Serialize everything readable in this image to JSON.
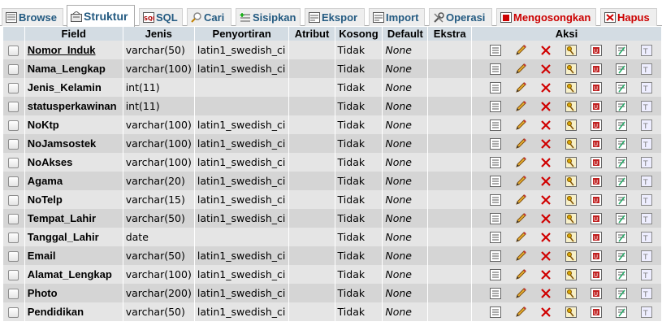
{
  "tabs": [
    {
      "label": "Browse",
      "icon": "browse-icon",
      "active": false
    },
    {
      "label": "Struktur",
      "icon": "structure-icon",
      "active": true
    },
    {
      "label": "SQL",
      "icon": "sql-icon",
      "active": false
    },
    {
      "label": "Cari",
      "icon": "search-icon",
      "active": false
    },
    {
      "label": "Sisipkan",
      "icon": "insert-icon",
      "active": false
    },
    {
      "label": "Ekspor",
      "icon": "export-icon",
      "active": false
    },
    {
      "label": "Import",
      "icon": "import-icon",
      "active": false
    },
    {
      "label": "Operasi",
      "icon": "operations-icon",
      "active": false
    },
    {
      "label": "Mengosongkan",
      "icon": "empty-icon",
      "active": false
    },
    {
      "label": "Hapus",
      "icon": "drop-icon",
      "active": false
    }
  ],
  "headers": {
    "field": "Field",
    "jenis": "Jenis",
    "penyortiran": "Penyortiran",
    "atribut": "Atribut",
    "kosong": "Kosong",
    "default": "Default",
    "ekstra": "Ekstra",
    "aksi": "Aksi"
  },
  "rows": [
    {
      "field": "Nomor_Induk",
      "jenis": "varchar(50)",
      "penyortiran": "latin1_swedish_ci",
      "atribut": "",
      "kosong": "Tidak",
      "default": "None",
      "ekstra": ""
    },
    {
      "field": "Nama_Lengkap",
      "jenis": "varchar(100)",
      "penyortiran": "latin1_swedish_ci",
      "atribut": "",
      "kosong": "Tidak",
      "default": "None",
      "ekstra": ""
    },
    {
      "field": "Jenis_Kelamin",
      "jenis": "int(11)",
      "penyortiran": "",
      "atribut": "",
      "kosong": "Tidak",
      "default": "None",
      "ekstra": ""
    },
    {
      "field": "statusperkawinan",
      "jenis": "int(11)",
      "penyortiran": "",
      "atribut": "",
      "kosong": "Tidak",
      "default": "None",
      "ekstra": ""
    },
    {
      "field": "NoKtp",
      "jenis": "varchar(100)",
      "penyortiran": "latin1_swedish_ci",
      "atribut": "",
      "kosong": "Tidak",
      "default": "None",
      "ekstra": ""
    },
    {
      "field": "NoJamsostek",
      "jenis": "varchar(100)",
      "penyortiran": "latin1_swedish_ci",
      "atribut": "",
      "kosong": "Tidak",
      "default": "None",
      "ekstra": ""
    },
    {
      "field": "NoAkses",
      "jenis": "varchar(100)",
      "penyortiran": "latin1_swedish_ci",
      "atribut": "",
      "kosong": "Tidak",
      "default": "None",
      "ekstra": ""
    },
    {
      "field": "Agama",
      "jenis": "varchar(20)",
      "penyortiran": "latin1_swedish_ci",
      "atribut": "",
      "kosong": "Tidak",
      "default": "None",
      "ekstra": ""
    },
    {
      "field": "NoTelp",
      "jenis": "varchar(15)",
      "penyortiran": "latin1_swedish_ci",
      "atribut": "",
      "kosong": "Tidak",
      "default": "None",
      "ekstra": ""
    },
    {
      "field": "Tempat_Lahir",
      "jenis": "varchar(50)",
      "penyortiran": "latin1_swedish_ci",
      "atribut": "",
      "kosong": "Tidak",
      "default": "None",
      "ekstra": ""
    },
    {
      "field": "Tanggal_Lahir",
      "jenis": "date",
      "penyortiran": "",
      "atribut": "",
      "kosong": "Tidak",
      "default": "None",
      "ekstra": ""
    },
    {
      "field": "Email",
      "jenis": "varchar(50)",
      "penyortiran": "latin1_swedish_ci",
      "atribut": "",
      "kosong": "Tidak",
      "default": "None",
      "ekstra": ""
    },
    {
      "field": "Alamat_Lengkap",
      "jenis": "varchar(100)",
      "penyortiran": "latin1_swedish_ci",
      "atribut": "",
      "kosong": "Tidak",
      "default": "None",
      "ekstra": ""
    },
    {
      "field": "Photo",
      "jenis": "varchar(200)",
      "penyortiran": "latin1_swedish_ci",
      "atribut": "",
      "kosong": "Tidak",
      "default": "None",
      "ekstra": ""
    },
    {
      "field": "Pendidikan",
      "jenis": "varchar(50)",
      "penyortiran": "latin1_swedish_ci",
      "atribut": "",
      "kosong": "Tidak",
      "default": "None",
      "ekstra": ""
    }
  ],
  "primary_key_field": "Nomor_Induk",
  "row_actions": [
    "browse-distinct-icon",
    "edit-pencil-icon",
    "drop-x-icon",
    "primary-key-icon",
    "unique-icon",
    "index-icon",
    "fulltext-icon"
  ],
  "colors": {
    "header_bg": "#d3dce3",
    "row_odd": "#e5e5e5",
    "row_even": "#d5d5d5",
    "tab_text": "#235a81",
    "tab_text_danger": "#cc0000"
  }
}
